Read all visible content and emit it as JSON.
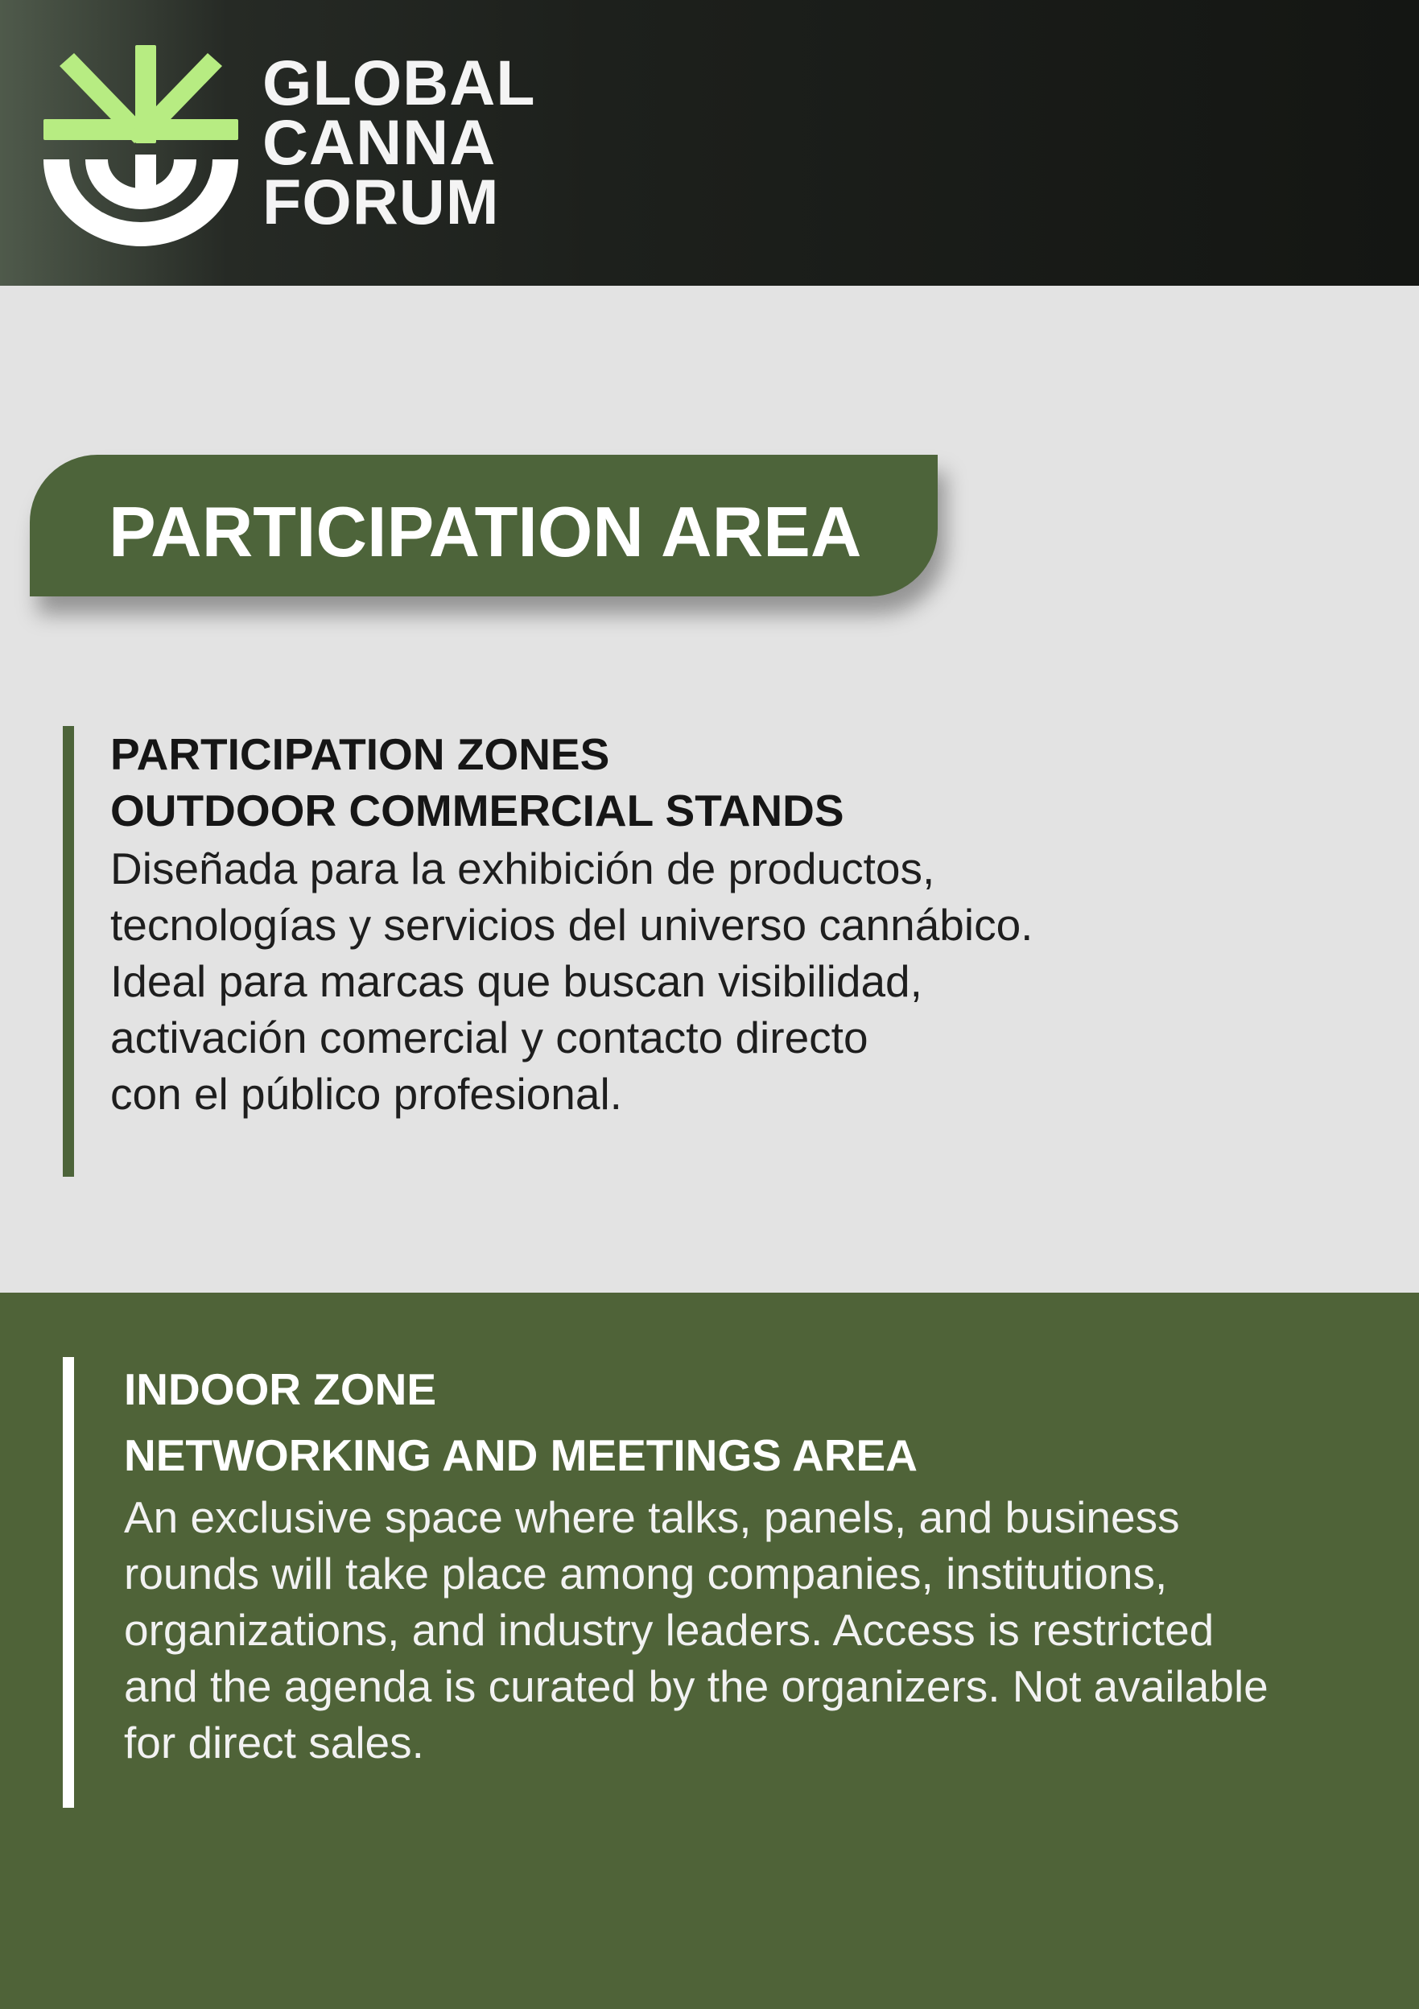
{
  "header": {
    "brand_lines": [
      "GLOBAL",
      "CANNA",
      "FORUM"
    ],
    "logo_icon": "cannabis-leaf-globe-icon",
    "colors": {
      "leaf": "#b7ec82",
      "arc": "#ffffff",
      "background": "#1b1e1a"
    }
  },
  "banner": {
    "title": "PARTICIPATION AREA",
    "color": "#4d643a"
  },
  "outdoor_section": {
    "heading_lines": [
      "PARTICIPATION ZONES",
      "OUTDOOR COMMERCIAL STANDS"
    ],
    "body_lines": [
      "Diseñada para la exhibición de productos,",
      "tecnologías y servicios del universo cannábico.",
      "Ideal para marcas que buscan visibilidad,",
      "activación comercial y contacto directo",
      "con el público profesional."
    ]
  },
  "indoor_section": {
    "heading_lines": [
      "INDOOR ZONE",
      "NETWORKING AND MEETINGS AREA"
    ],
    "body_lines": [
      "An exclusive space where talks, panels, and business",
      "rounds will take place among companies, institutions,",
      "organizations, and industry leaders. Access is restricted",
      "and the agenda is curated by the organizers. Not available",
      "for direct sales."
    ],
    "background_color": "#4f6338"
  }
}
